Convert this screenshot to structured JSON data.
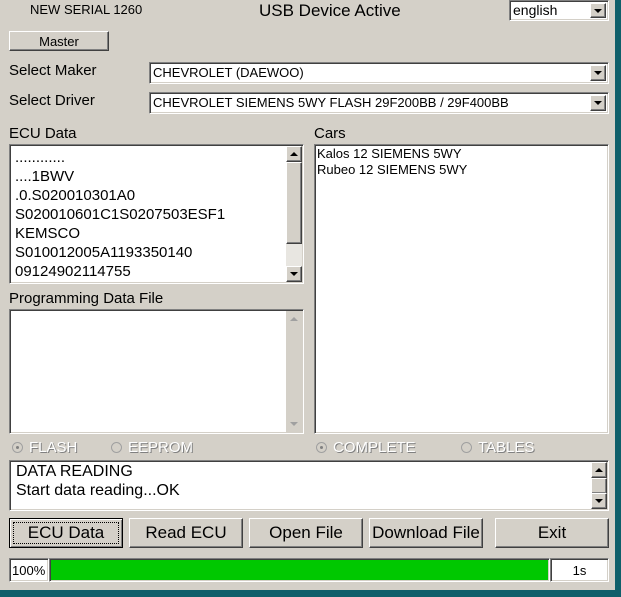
{
  "header": {
    "serial": "NEW SERIAL 1260",
    "status": "USB Device Active",
    "language": "english"
  },
  "master_button": "Master",
  "maker": {
    "label": "Select Maker",
    "value": "CHEVROLET (DAEWOO)"
  },
  "driver": {
    "label": "Select Driver",
    "value": "CHEVROLET SIEMENS 5WY FLASH 29F200BB / 29F400BB"
  },
  "ecu_data": {
    "label": "ECU Data",
    "lines": [
      "............",
      "....1BWV",
      ".0.S020010301A0",
      "S020010601C1S0207503ESF1",
      "KEMSCO",
      "S010012005A1193350140",
      "09124902114755"
    ]
  },
  "cars": {
    "label": "Cars",
    "items": [
      "Kalos 12 SIEMENS 5WY",
      "Rubeo 12 SIEMENS 5WY"
    ]
  },
  "programming": {
    "label": "Programming Data File",
    "lines": []
  },
  "options": {
    "flash": "FLASH",
    "eeprom": "EEPROM",
    "complete": "COMPLETE",
    "tables": "TABLES"
  },
  "log": {
    "lines": [
      "DATA READING",
      "Start data reading...OK"
    ]
  },
  "buttons": {
    "ecu_data": "ECU Data",
    "read_ecu": "Read ECU",
    "open_file": "Open File",
    "download_file": "Download File",
    "exit": "Exit"
  },
  "progress": {
    "percent_label": "100%",
    "fraction": 1.0,
    "time": "1s",
    "color": "#00c800"
  }
}
